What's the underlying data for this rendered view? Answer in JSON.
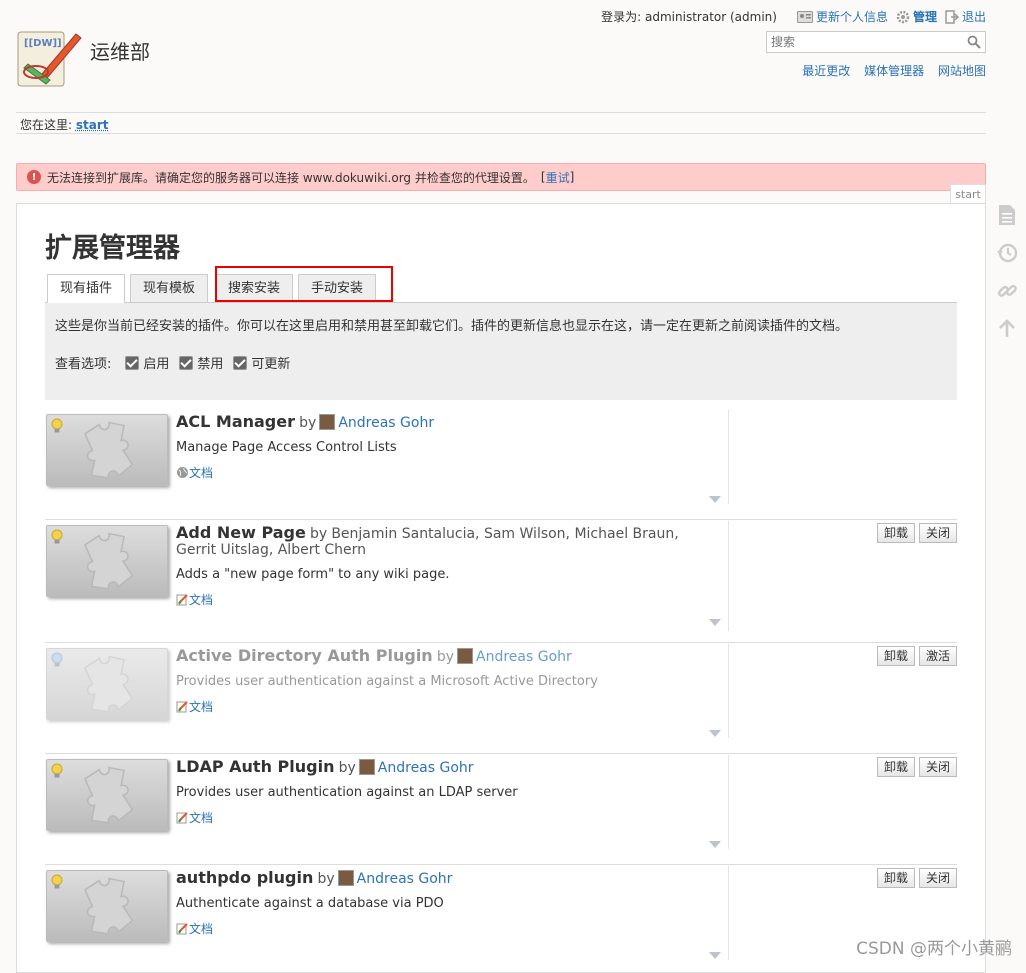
{
  "site": {
    "title": "运维部"
  },
  "user_bar": {
    "login_text": "登录为: administrator (admin)",
    "profile": "更新个人信息",
    "admin": "管理",
    "logout": "退出"
  },
  "search": {
    "placeholder": "搜索"
  },
  "tools": {
    "recent": "最近更改",
    "media": "媒体管理器",
    "sitemap": "网站地图"
  },
  "breadcrumb": {
    "label": "您在这里:",
    "link": "start"
  },
  "error": {
    "text": "无法连接到扩展库。请确定您的服务器可以连接 www.dokuwiki.org 并检查您的代理设置。",
    "retry_open": "[",
    "retry": "重试",
    "retry_close": "]"
  },
  "page_id": "start",
  "main": {
    "heading": "扩展管理器",
    "tabs": [
      "现有插件",
      "现有模板",
      "搜索安装",
      "手动安装"
    ],
    "intro": "这些是你当前已经安装的插件。你可以在这里启用和禁用甚至卸载它们。插件的更新信息也显示在这，请一定在更新之前阅读插件的文档。",
    "filters_label": "查看选项:",
    "filters": [
      "启用",
      "禁用",
      "可更新"
    ]
  },
  "plugins": [
    {
      "name": "ACL Manager",
      "by": "by",
      "author": "Andreas Gohr",
      "authors_plain": "",
      "desc": "Manage Page Access Control Lists",
      "doc": "文档",
      "buttons": [],
      "enabled": true
    },
    {
      "name": "Add New Page",
      "by": "by",
      "author": "",
      "authors_plain": "Benjamin Santalucia, Sam Wilson, Michael Braun, Gerrit Uitslag, Albert Chern",
      "desc": "Adds a \"new page form\" to any wiki page.",
      "doc": "文档",
      "buttons": [
        "卸载",
        "关闭"
      ],
      "enabled": true
    },
    {
      "name": "Active Directory Auth Plugin",
      "by": "by",
      "author": "Andreas Gohr",
      "authors_plain": "",
      "desc": "Provides user authentication against a Microsoft Active Directory",
      "doc": "文档",
      "buttons": [
        "卸载",
        "激活"
      ],
      "enabled": false
    },
    {
      "name": "LDAP Auth Plugin",
      "by": "by",
      "author": "Andreas Gohr",
      "authors_plain": "",
      "desc": "Provides user authentication against an LDAP server",
      "doc": "文档",
      "buttons": [
        "卸载",
        "关闭"
      ],
      "enabled": true
    },
    {
      "name": "authpdo plugin",
      "by": "by",
      "author": "Andreas Gohr",
      "authors_plain": "",
      "desc": "Authenticate against a database via PDO",
      "doc": "文档",
      "buttons": [
        "卸载",
        "关闭"
      ],
      "enabled": true
    }
  ],
  "watermark": "CSDN @两个小黄鹂"
}
